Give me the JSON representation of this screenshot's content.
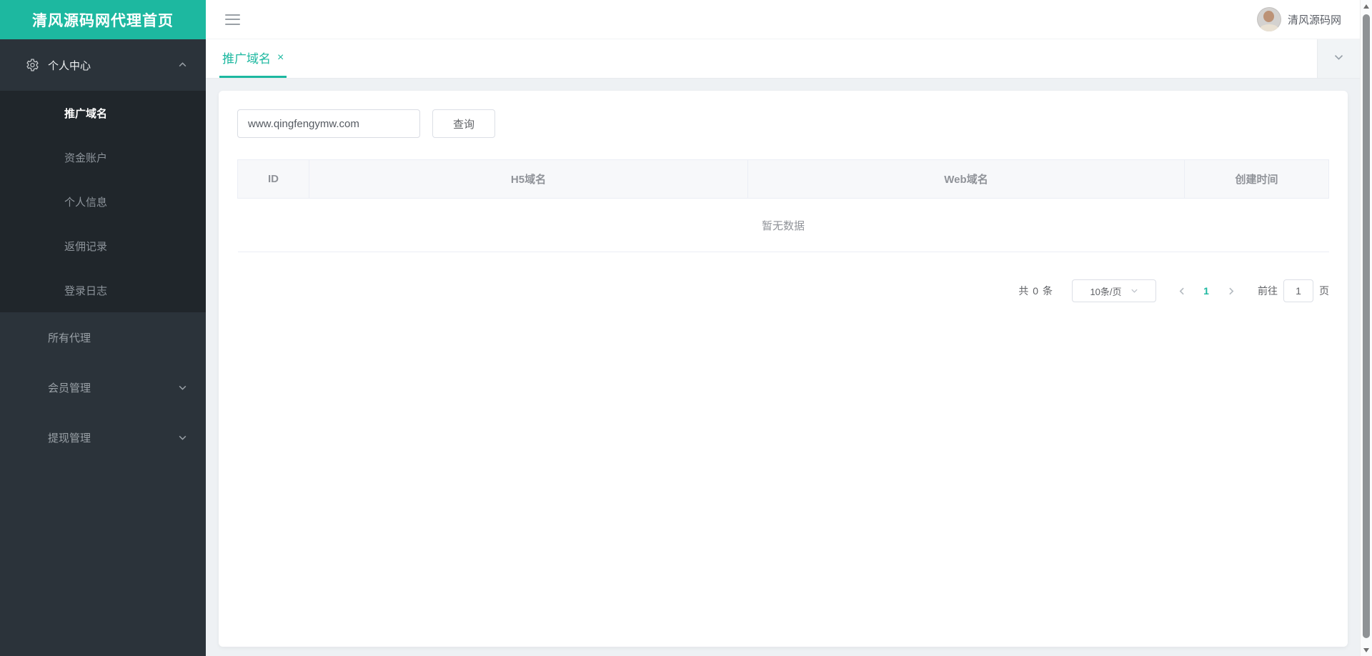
{
  "colors": {
    "accent": "#1db8a0",
    "sidebar_bg": "#2b333a",
    "submenu_bg": "#20262b",
    "content_bg": "#eef1f4"
  },
  "sidebar": {
    "logo_title": "清风源码网代理首页",
    "personal_center": {
      "label": "个人中心",
      "icon": "gear-icon",
      "state": "expanded"
    },
    "submenu": [
      {
        "label": "推广域名",
        "active": true
      },
      {
        "label": "资金账户"
      },
      {
        "label": "个人信息"
      },
      {
        "label": "返佣记录"
      },
      {
        "label": "登录日志"
      }
    ],
    "items": [
      {
        "label": "所有代理",
        "has_children": false
      },
      {
        "label": "会员管理",
        "has_children": true
      },
      {
        "label": "提现管理",
        "has_children": true
      }
    ]
  },
  "header": {
    "user_name": "清风源码网"
  },
  "tabs": {
    "active_tab": {
      "label": "推广域名",
      "close_glyph": "×"
    }
  },
  "search": {
    "value": "www.qingfengymw.com",
    "query_button": "查询"
  },
  "table": {
    "columns": [
      "ID",
      "H5域名",
      "Web域名",
      "创建时间"
    ],
    "empty_text": "暂无数据",
    "rows": []
  },
  "pagination": {
    "total_text": "共 0 条",
    "page_size": "10条/页",
    "current_page": "1",
    "goto_label": "前往",
    "goto_value": "1",
    "page_unit": "页"
  }
}
